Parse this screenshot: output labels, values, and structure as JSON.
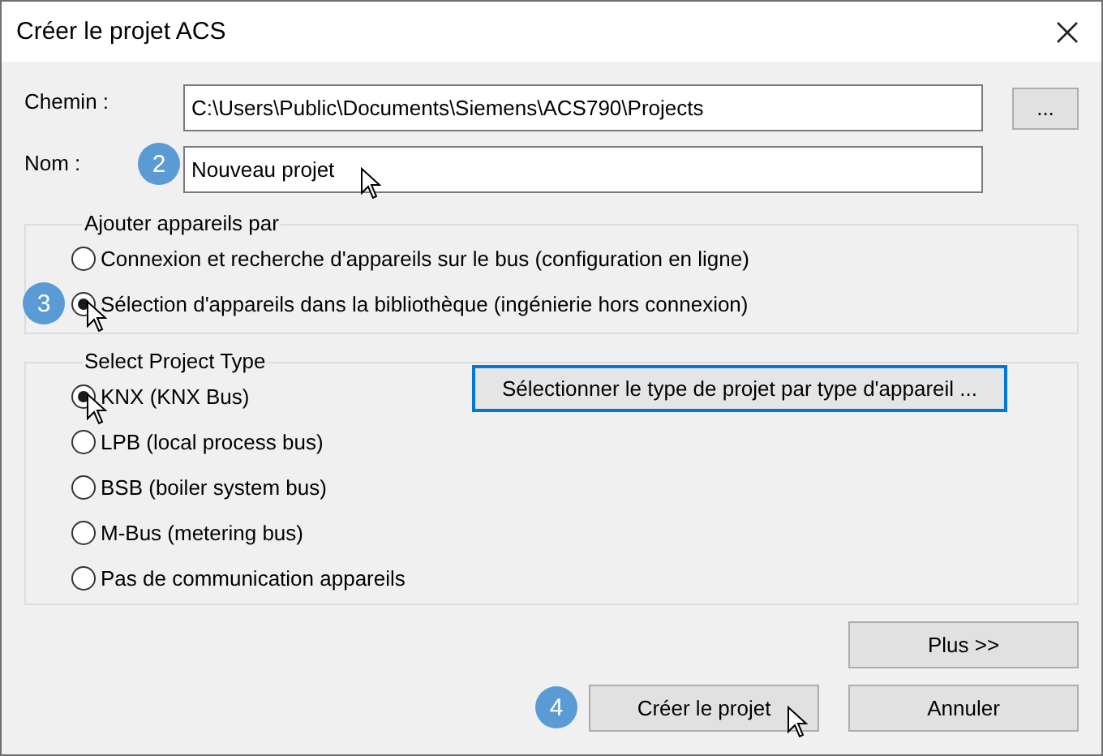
{
  "window": {
    "title": "Créer le projet ACS"
  },
  "path": {
    "label": "Chemin :",
    "value": "C:\\Users\\Public\\Documents\\Siemens\\ACS790\\Projects",
    "browse": "..."
  },
  "name": {
    "label": "Nom :",
    "value": "Nouveau projet",
    "step": "2"
  },
  "add_devices": {
    "title": "Ajouter appareils par",
    "step": "3",
    "options": [
      {
        "label": "Connexion et recherche d'appareils sur le bus (configuration en ligne)",
        "selected": false
      },
      {
        "label": "Sélection d'appareils dans la bibliothèque (ingénierie hors connexion)",
        "selected": true
      }
    ]
  },
  "project_type": {
    "title": "Select Project Type",
    "button": "Sélectionner le type de projet par type d'appareil ...",
    "options": [
      {
        "label": "KNX (KNX Bus)",
        "selected": true
      },
      {
        "label": "LPB (local process bus)",
        "selected": false
      },
      {
        "label": "BSB (boiler system bus)",
        "selected": false
      },
      {
        "label": "M-Bus (metering bus)",
        "selected": false
      },
      {
        "label": "Pas de communication appareils",
        "selected": false
      }
    ]
  },
  "buttons": {
    "more": "Plus >>",
    "create": "Créer le projet",
    "create_step": "4",
    "cancel": "Annuler"
  }
}
